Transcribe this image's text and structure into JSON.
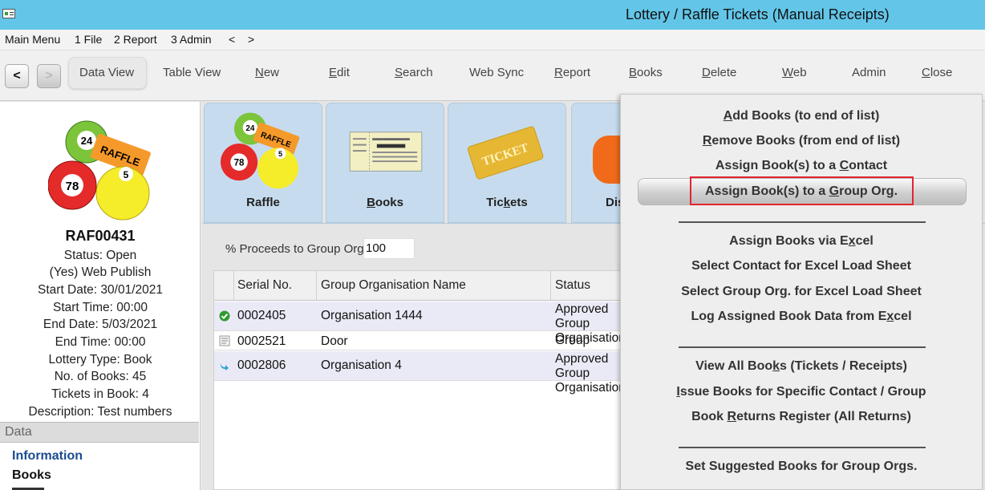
{
  "window": {
    "title": "Lottery / Raffle Tickets (Manual Receipts)"
  },
  "menubar": {
    "items": [
      "Main Menu",
      "1 File",
      "2 Report",
      "3 Admin",
      "<",
      ">"
    ]
  },
  "toolbar": {
    "back": "<",
    "forward": ">",
    "data_view": "Data View",
    "table_view": "Table View",
    "new_first": "N",
    "new_rest": "ew",
    "edit_first": "E",
    "edit_rest": "dit",
    "search_pre": "S",
    "search_rest": "earch",
    "web_sync": "Web Sync",
    "report_pre": "R",
    "report_rest": "eport",
    "books_pre": "B",
    "books_rest": "ooks",
    "delete_pre": "D",
    "delete_rest": "elete",
    "web_pre": "W",
    "web_rest": "eb",
    "admin": "Admin",
    "close_pre": "C",
    "close_rest": "lose"
  },
  "record": {
    "logo_balls": [
      "24",
      "78",
      "5"
    ],
    "logo_ticket": "RAFFLE",
    "id": "RAF00431",
    "lines": [
      "Status: Open",
      "(Yes) Web Publish",
      "Start Date: 30/01/2021",
      "Start Time: 00:00",
      "End Date: 5/03/2021",
      "End Time: 00:00",
      "Lottery Type: Book",
      "No. of Books: 45",
      "Tickets in Book: 4",
      "Description: Test numbers"
    ]
  },
  "left_nav": {
    "header": "Data",
    "information": "Information",
    "books": "Books"
  },
  "tiles": {
    "raffle": "Raffle",
    "raffle_balls": [
      "24",
      "78",
      "5"
    ],
    "raffle_ticket": "RAFFLE",
    "books_pre": "B",
    "books_rest": "ooks",
    "tickets_pre": "Tic",
    "tickets_k": "k",
    "tickets_rest": "ets",
    "ticket_art": "TICKET",
    "display_partial": "Dis"
  },
  "form": {
    "proceeds_label": "% Proceeds to Group Org.",
    "proceeds_value": "100"
  },
  "grid": {
    "headers": [
      "Serial No.",
      "Group Organisation Name",
      "Status"
    ],
    "rows": [
      {
        "serial": "0002405",
        "name": "Organisation 1444",
        "status": "Approved Group Organisation"
      },
      {
        "serial": "0002521",
        "name": "Door",
        "status": "Group"
      },
      {
        "serial": "0002806",
        "name": "Organisation 4",
        "status": "Approved Group Organisation"
      }
    ]
  },
  "books_menu": {
    "add_pre": "",
    "add_u": "A",
    "add_rest": "dd Books (to end of list)",
    "remove_u": "R",
    "remove_rest": "emove Books (from end of list)",
    "contact_pre": "Assign Book(s) to a ",
    "contact_u": "C",
    "contact_rest": "ontact",
    "group_pre": "Assign Book(s) to a ",
    "group_u": "G",
    "group_rest": "roup Org.",
    "excel_pre": "Assign Books via E",
    "excel_u": "x",
    "excel_rest": "cel",
    "select_contact": "Select Contact for Excel Load Sheet",
    "select_group": "Select Group Org. for Excel Load Sheet",
    "log_pre": "Log Assigned Book Data from E",
    "log_u": "x",
    "log_rest": "cel",
    "view_pre": "View All Boo",
    "view_u": "k",
    "view_rest": "s (Tickets / Receipts)",
    "issue_u": "I",
    "issue_rest": "ssue Books for Specific Contact / Group",
    "returns_pre": "Book ",
    "returns_u": "R",
    "returns_rest": "eturns Register (All Returns)",
    "suggested": "Set Suggested Books for Group Orgs."
  },
  "colors": {
    "titlebar": "#63c6e9",
    "tile": "#c6dcee",
    "highlight": "#e3252e",
    "link": "#1a4c90"
  }
}
